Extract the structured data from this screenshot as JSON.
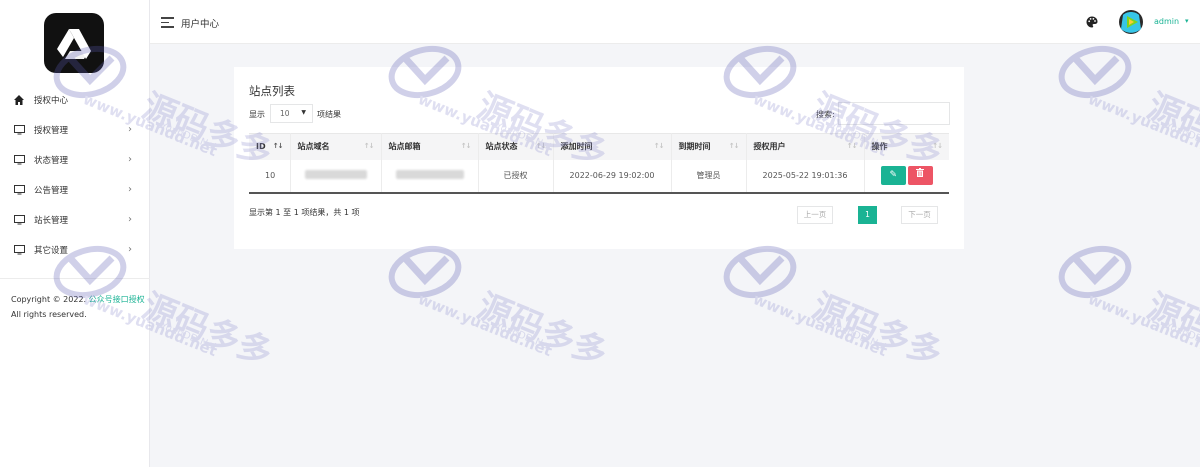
{
  "header": {
    "title": "用户中心",
    "user": "admin",
    "icons": [
      "menu-icon",
      "palette-icon"
    ]
  },
  "sidebar": {
    "items": [
      {
        "label": "授权中心",
        "icon": "home-icon"
      },
      {
        "label": "授权管理",
        "icon": "monitor-icon"
      },
      {
        "label": "状态管理",
        "icon": "monitor-icon"
      },
      {
        "label": "公告管理",
        "icon": "monitor-icon"
      },
      {
        "label": "站长管理",
        "icon": "monitor-icon"
      },
      {
        "label": "其它设置",
        "icon": "monitor-icon"
      }
    ],
    "copyright_prefix": "Copyright © 2022.",
    "copyright_link": "公众号接口授权",
    "copyright_suffix": "All rights reserved."
  },
  "card": {
    "title": "站点列表",
    "length_label": "显示",
    "length_value": "10",
    "length_suffix": "项结果",
    "search_label": "搜索:",
    "columns": [
      "ID",
      "站点域名",
      "站点邮箱",
      "站点状态",
      "添加时间",
      "到期时间",
      "授权用户",
      "操作"
    ],
    "rows": [
      {
        "id": "10",
        "status": "已授权",
        "added": "2022-06-29 19:02:00",
        "expire": "管理员",
        "user": "2025-05-22 19:01:36"
      }
    ],
    "info": "显示第 1 至 1 项结果，共 1 项",
    "pagination": {
      "prev": "上一页",
      "current": "1",
      "next": "下一页"
    }
  },
  "watermark": {
    "text_cn": "源码多多",
    "text_en": "YuanDD.Net",
    "url": "www.yuandd.net"
  },
  "colors": {
    "accent": "#1ab394",
    "danger": "#ed5565",
    "logo_bg": "#111111"
  }
}
